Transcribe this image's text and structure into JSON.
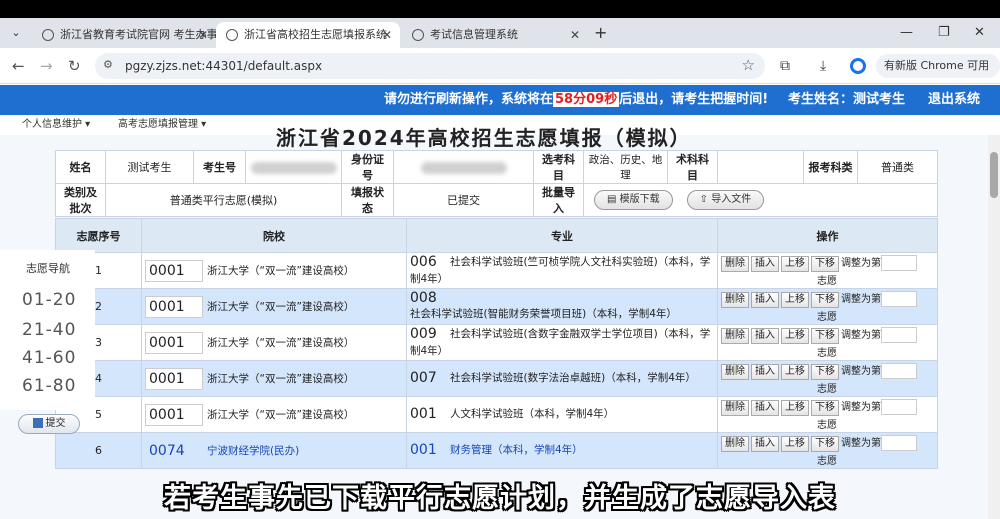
{
  "browser": {
    "tabs": [
      {
        "title": "浙江省教育考试院官网 考生办事",
        "active": false
      },
      {
        "title": "浙江省高校招生志愿填报系统",
        "active": true
      },
      {
        "title": "考试信息管理系统",
        "active": false
      }
    ],
    "url": "pgzy.zjzs.net:44301/default.aspx",
    "new_version_label": "有新版 Chrome 可用",
    "icons": {
      "tab_list": "chevron-down-icon",
      "new_tab": "plus-icon",
      "back": "arrow-left-icon",
      "forward": "arrow-right-icon",
      "reload": "reload-icon",
      "bookmark": "star-icon",
      "extensions": "puzzle-icon",
      "download": "download-icon",
      "menu": "more-vert-icon"
    }
  },
  "header": {
    "warning_prefix": "请勿进行刷新操作，系统将在",
    "countdown": "58分09秒",
    "warning_suffix": "后退出，请考生把握时间!",
    "student_name": "考生姓名：测试考生",
    "logout": "退出系统",
    "accent_color": "#1e6fd0",
    "countdown_color": "#e02020"
  },
  "menu": {
    "personal": "个人信息维护 ▾",
    "volunteer": "高考志愿填报管理 ▾"
  },
  "page": {
    "title_partial": "浙江省2024年高校招生志愿填报（模拟）"
  },
  "info": {
    "name_label": "姓名",
    "name_value": "测试考生",
    "exam_no_label": "考生号",
    "id_label": "身份证号",
    "subjects_label": "选考科目",
    "subjects_value": "政治、历史、地理",
    "tech_label": "术科科目",
    "tech_value": "",
    "type_label": "报考科类",
    "type_value": "普通类",
    "batch_label": "类别及批次",
    "batch_value": "普通类平行志愿(模拟)",
    "status_label": "填报状态",
    "status_value": "已提交",
    "bulk_label": "批量导入",
    "template_btn": "模版下载",
    "import_btn": "导入文件"
  },
  "choices": {
    "headers": {
      "seq": "志愿序号",
      "school": "院校",
      "major": "专业",
      "ops": "操作"
    },
    "op_labels": {
      "delete": "删除",
      "insert": "插入",
      "up": "上移",
      "down": "下移",
      "adjust_prefix": "调整为第",
      "adjust_suffix": "志愿"
    },
    "rows": [
      {
        "seq": "1",
        "school_code": "0001",
        "school_name": "浙江大学（“双一流”建设高校）",
        "major_code": "006",
        "major_name": "社会科学试验班(竺可桢学院人文社科实验班)（本科，学制4年）"
      },
      {
        "seq": "2",
        "school_code": "0001",
        "school_name": "浙江大学（“双一流”建设高校）",
        "major_code": "008",
        "major_name": "社会科学试验班(智能财务荣誉项目班)（本科，学制4年）"
      },
      {
        "seq": "3",
        "school_code": "0001",
        "school_name": "浙江大学（“双一流”建设高校）",
        "major_code": "009",
        "major_name": "社会科学试验班(含数字金融双学士学位项目)（本科，学制4年）"
      },
      {
        "seq": "4",
        "school_code": "0001",
        "school_name": "浙江大学（“双一流”建设高校）",
        "major_code": "007",
        "major_name": "社会科学试验班(数字法治卓越班)（本科，学制4年）"
      },
      {
        "seq": "5",
        "school_code": "0001",
        "school_name": "浙江大学（“双一流”建设高校）",
        "major_code": "001",
        "major_name": "人文科学试验班（本科，学制4年）"
      },
      {
        "seq": "6",
        "school_code": "0074",
        "school_name": "宁波财经学院(民办)",
        "major_code": "001",
        "major_name": "财务管理（本科，学制4年）"
      }
    ]
  },
  "sidenav": {
    "title": "志愿导航",
    "ranges": [
      "01-20",
      "21-40",
      "41-60",
      "61-80"
    ],
    "submit": "提交"
  },
  "caption": "若考生事先已下载平行志愿计划，并生成了志愿导入表"
}
